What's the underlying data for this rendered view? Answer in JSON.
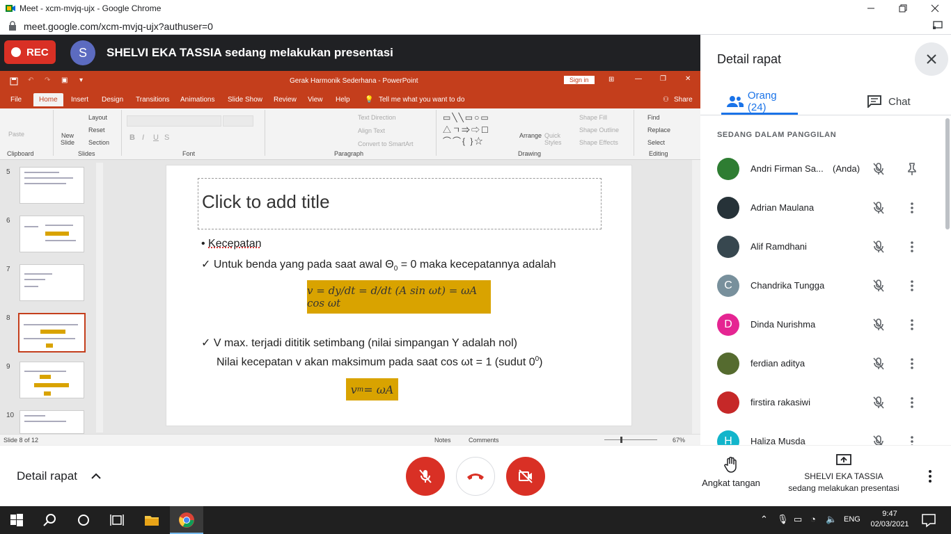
{
  "browser": {
    "tab_title": "Meet - xcm-mvjq-ujx - Google Chrome",
    "url": "meet.google.com/xcm-mvjq-ujx?authuser=0"
  },
  "meet_bar": {
    "rec_label": "REC",
    "presenter_initial": "S",
    "presenter_message": "SHELVI EKA TASSIA sedang melakukan presentasi"
  },
  "powerpoint": {
    "window_title": "Gerak Harmonik Sederhana  -  PowerPoint",
    "sign_in": "Sign in",
    "tabs": [
      "File",
      "Home",
      "Insert",
      "Design",
      "Transitions",
      "Animations",
      "Slide Show",
      "Review",
      "View",
      "Help"
    ],
    "tell_me": "Tell me what you want to do",
    "share": "Share",
    "ribbon": {
      "paste": "Paste",
      "clipboard": "Clipboard",
      "new_slide": "New Slide",
      "layout": "Layout",
      "reset": "Reset",
      "section": "Section",
      "slides": "Slides",
      "font": "Font",
      "text_direction": "Text Direction",
      "align_text": "Align Text",
      "convert_smartart": "Convert to SmartArt",
      "paragraph": "Paragraph",
      "arrange": "Arrange",
      "quick_styles": "Quick Styles",
      "shape_fill": "Shape Fill",
      "shape_outline": "Shape Outline",
      "shape_effects": "Shape Effects",
      "drawing": "Drawing",
      "find": "Find",
      "replace": "Replace",
      "select": "Select",
      "editing": "Editing"
    },
    "thumbnails": [
      "5",
      "6",
      "7",
      "8",
      "9",
      "10"
    ],
    "selected_thumbnail": "8",
    "slide": {
      "title_placeholder": "Click to add title",
      "bullet1": "Kecepatan",
      "check1_a": "Untuk benda yang pada saat awal Θ",
      "check1_sub": "0",
      "check1_b": " = 0 maka kecepatannya adalah",
      "formula1": "v = dy/dt = d/dt (A sin ωt) = ωA cos ωt",
      "check2": "V max. terjadi dititik setimbang (nilai simpangan Y adalah nol)",
      "line3_a": "Nilai kecepatan v akan maksimum pada saat cos ωt = 1 (sudut 0",
      "line3_sup": "0",
      "line3_b": ")",
      "formula2": "v",
      "formula2_sub": "m",
      "formula2_rest": " = ωA"
    },
    "status": {
      "slide_of": "Slide 8 of 12",
      "notes": "Notes",
      "comments": "Comments",
      "zoom": "67%"
    }
  },
  "panel": {
    "title": "Detail rapat",
    "tab_people": "Orang (24)",
    "tab_chat": "Chat",
    "section_label": "SEDANG DALAM PANGGILAN",
    "people": [
      {
        "name": "Andri Firman Sa...",
        "you": "(Anda)",
        "initial": "",
        "color": "#2e7d32"
      },
      {
        "name": "Adrian Maulana",
        "you": "",
        "initial": "",
        "color": "#263238"
      },
      {
        "name": "Alif Ramdhani",
        "you": "",
        "initial": "",
        "color": "#37474f"
      },
      {
        "name": "Chandrika Tungga",
        "you": "",
        "initial": "C",
        "color": "#78909c"
      },
      {
        "name": "Dinda Nurishma",
        "you": "",
        "initial": "D",
        "color": "#e52592"
      },
      {
        "name": "ferdian aditya",
        "you": "",
        "initial": "",
        "color": "#556b2f"
      },
      {
        "name": "firstira rakasiwi",
        "you": "",
        "initial": "",
        "color": "#c62828"
      },
      {
        "name": "Haliza Musda",
        "you": "",
        "initial": "H",
        "color": "#12b5cb"
      }
    ]
  },
  "bottom": {
    "details_label": "Detail rapat",
    "raise_hand": "Angkat tangan",
    "presenting_name": "SHELVI EKA TASSIA",
    "presenting_text": "sedang melakukan presentasi"
  },
  "taskbar": {
    "lang": "ENG",
    "time": "9:47",
    "date": "02/03/2021"
  }
}
